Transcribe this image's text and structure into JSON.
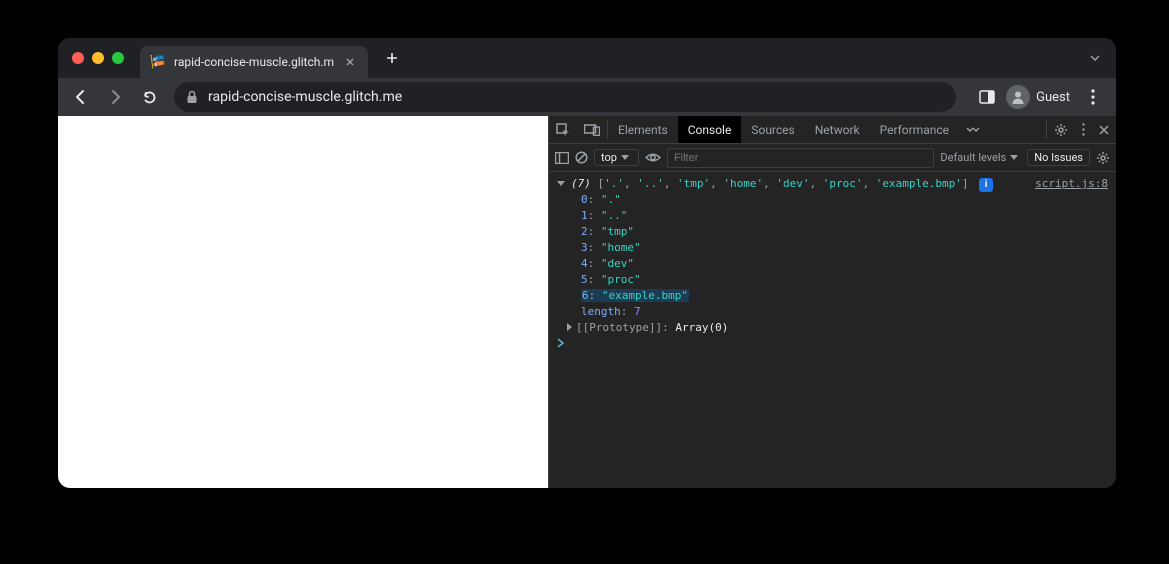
{
  "tab": {
    "title": "rapid-concise-muscle.glitch.m",
    "favicon": "🎏"
  },
  "url": "rapid-concise-muscle.glitch.me",
  "guest_label": "Guest",
  "devtools": {
    "tabs": {
      "elements": "Elements",
      "console": "Console",
      "sources": "Sources",
      "network": "Network",
      "performance": "Performance"
    },
    "context": "top",
    "filter_placeholder": "Filter",
    "levels": "Default levels",
    "issues": "No Issues",
    "src_link": "script.js:8"
  },
  "console_array": {
    "length_label": "length",
    "length_value": "7",
    "count": "(7)",
    "summary_items": [
      "'.'",
      "'..'",
      "'tmp'",
      "'home'",
      "'dev'",
      "'proc'",
      "'example.bmp'"
    ],
    "entries": [
      {
        "idx": "0",
        "val": "\".\""
      },
      {
        "idx": "1",
        "val": "\"..\""
      },
      {
        "idx": "2",
        "val": "\"tmp\""
      },
      {
        "idx": "3",
        "val": "\"home\""
      },
      {
        "idx": "4",
        "val": "\"dev\""
      },
      {
        "idx": "5",
        "val": "\"proc\""
      },
      {
        "idx": "6",
        "val": "\"example.bmp\"",
        "hl": true
      }
    ],
    "proto_label": "[[Prototype]]",
    "proto_value": "Array(0)"
  }
}
